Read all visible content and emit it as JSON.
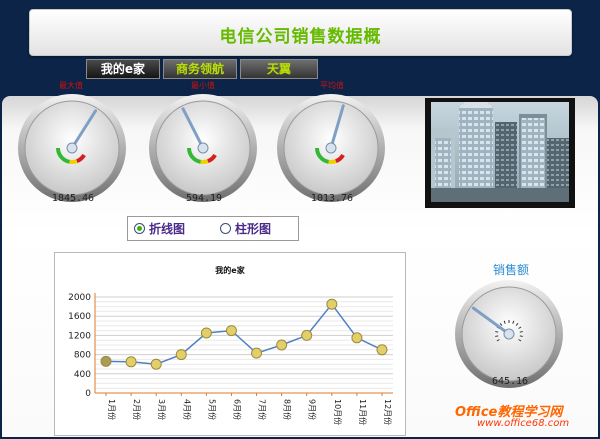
{
  "header": {
    "title": "电信公司销售数据概"
  },
  "tabs": [
    {
      "label": "我的e家",
      "active": true
    },
    {
      "label": "商务领航",
      "active": false
    },
    {
      "label": "天翼",
      "active": false
    }
  ],
  "gauges": [
    {
      "label": "最大值",
      "value": "1845.46",
      "needle_fraction": 0.62
    },
    {
      "label": "最小值",
      "value": "594.19",
      "needle_fraction": 0.4
    },
    {
      "label": "平均值",
      "value": "1013.76",
      "needle_fraction": 0.56
    }
  ],
  "chart_toggle": {
    "options": [
      {
        "label": "折线图",
        "selected": true
      },
      {
        "label": "柱形图",
        "selected": false
      }
    ]
  },
  "chart_data": {
    "type": "line",
    "title": "我的e家",
    "categories": [
      "1月份",
      "2月份",
      "3月份",
      "4月份",
      "5月份",
      "6月份",
      "7月份",
      "8月份",
      "9月份",
      "10月份",
      "11月份",
      "12月份"
    ],
    "values": [
      660,
      650,
      600,
      800,
      1250,
      1300,
      830,
      1000,
      1200,
      1850,
      1150,
      900
    ],
    "ylim": [
      0,
      2000
    ],
    "yticks": [
      0,
      400,
      800,
      1200,
      1600,
      2000
    ],
    "ytick_labels": [
      "0",
      "400",
      "800",
      "1200",
      "1600",
      "2000"
    ],
    "grid": true
  },
  "sales_gauge": {
    "label": "销售额",
    "value": "645.16",
    "needle_fraction": 0.3
  },
  "watermark": {
    "line1": "Office教程学习网",
    "line2": "www.office68.com"
  },
  "colors": {
    "title": "#66bb00",
    "tab_inactive_text": "#b7e000",
    "gauge_label": "#cc1111",
    "line": "#4f7fc4",
    "marker": "#e3cf6a",
    "sales_label": "#2a8bd6"
  }
}
